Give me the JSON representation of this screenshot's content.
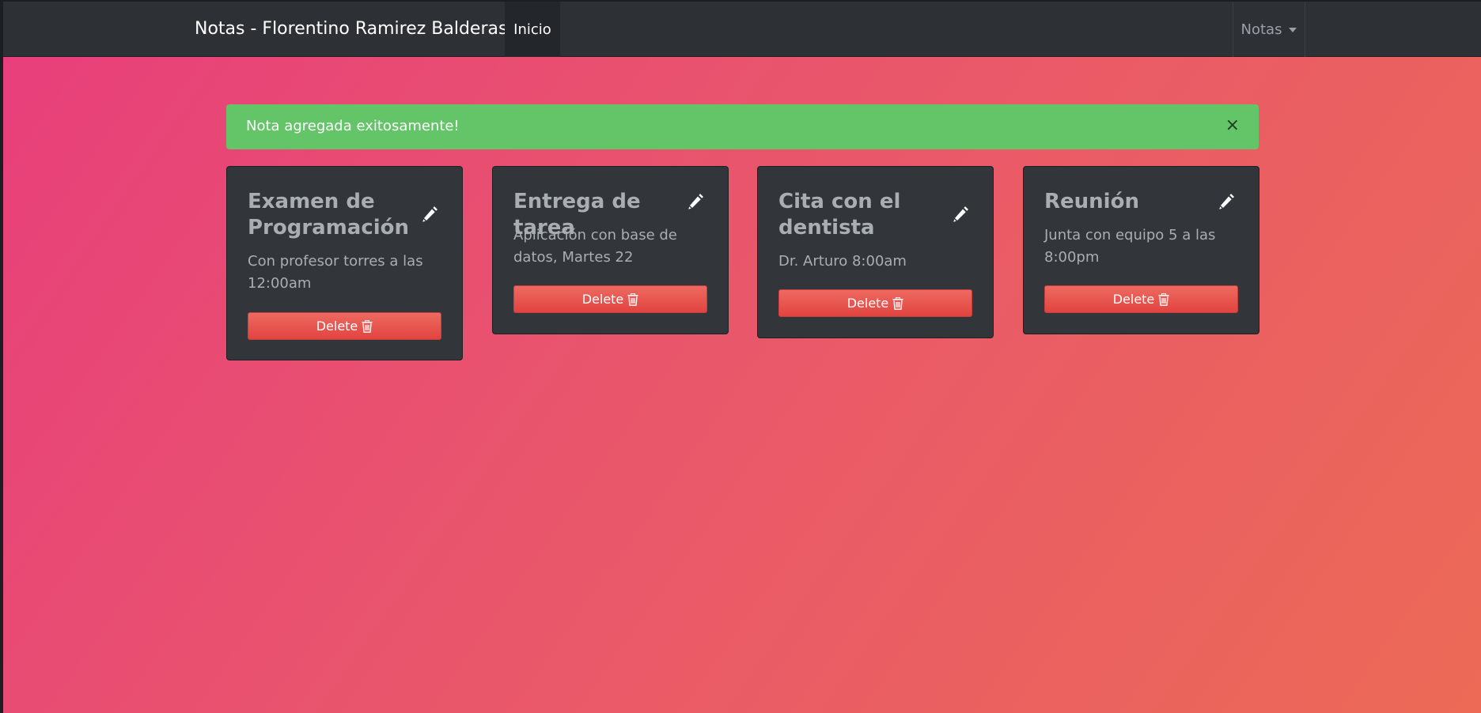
{
  "navbar": {
    "brand": "Notas - Florentino Ramirez Balderas",
    "home_label": "Inicio",
    "menu_label": "Notas"
  },
  "alert": {
    "message": "Nota agregada exitosamente!",
    "close_symbol": "×",
    "color": "#63c468"
  },
  "notes": [
    {
      "title": "Examen de Programación",
      "description": "Con profesor torres a las 12:00am",
      "delete_label": "Delete"
    },
    {
      "title": "Entrega de tarea",
      "description": "Aplicación con base de datos, Martes 22",
      "delete_label": "Delete"
    },
    {
      "title": "Cita con el dentista",
      "description": "Dr. Arturo 8:00am",
      "delete_label": "Delete"
    },
    {
      "title": "Reunión",
      "description": "Junta con equipo 5 a las 8:00pm",
      "delete_label": "Delete"
    }
  ],
  "icons": {
    "edit": "pencil-icon",
    "delete": "trash-icon",
    "dropdown": "caret-down-icon"
  },
  "colors": {
    "navbar": "#2d3136",
    "card": "#32363b",
    "delete_button": "#e2433f",
    "background_start": "#e83e7c",
    "background_end": "#ec6a56"
  }
}
